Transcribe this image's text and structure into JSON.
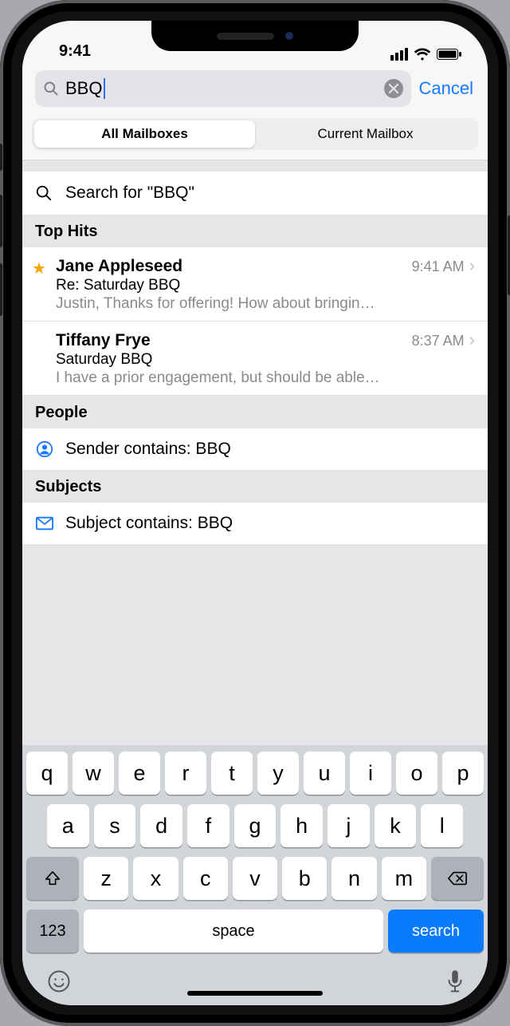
{
  "status_bar": {
    "time": "9:41"
  },
  "search": {
    "query": "BBQ",
    "cancel_label": "Cancel"
  },
  "segments": {
    "all": "All Mailboxes",
    "current": "Current Mailbox",
    "selected": "all"
  },
  "search_for": {
    "prefix": "Search for ",
    "quoted": "\"BBQ\""
  },
  "sections": {
    "top_hits": {
      "title": "Top Hits",
      "items": [
        {
          "sender": "Jane Appleseed",
          "time": "9:41 AM",
          "subject": "Re:  Saturday BBQ",
          "preview": "Justin, Thanks for offering! How about bringin…",
          "starred": true
        },
        {
          "sender": "Tiffany Frye",
          "time": "8:37 AM",
          "subject": "Saturday BBQ",
          "preview": "I have a prior engagement, but should be able…",
          "starred": false
        }
      ]
    },
    "people": {
      "title": "People",
      "label": "Sender contains: BBQ"
    },
    "subjects": {
      "title": "Subjects",
      "label": "Subject contains: BBQ"
    }
  },
  "keyboard": {
    "row1": [
      "q",
      "w",
      "e",
      "r",
      "t",
      "y",
      "u",
      "i",
      "o",
      "p"
    ],
    "row2": [
      "a",
      "s",
      "d",
      "f",
      "g",
      "h",
      "j",
      "k",
      "l"
    ],
    "row3": [
      "z",
      "x",
      "c",
      "v",
      "b",
      "n",
      "m"
    ],
    "num_label": "123",
    "space_label": "space",
    "search_label": "search"
  }
}
